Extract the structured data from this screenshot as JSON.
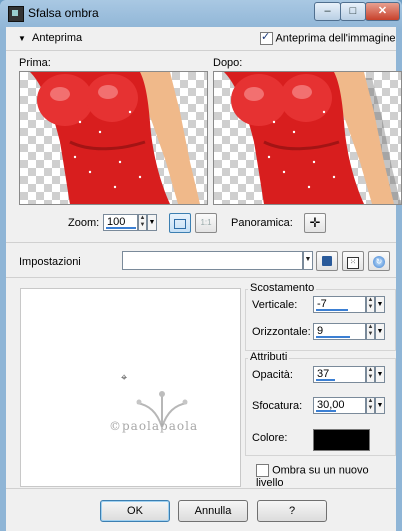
{
  "window": {
    "title": "Sfalsa ombra",
    "min": "–",
    "max": "□",
    "close": "✕"
  },
  "preview_section": {
    "collapse_label": "Anteprima",
    "show_preview_label": "Anteprima dell'immagine",
    "show_preview_checked": true,
    "before_label": "Prima:",
    "after_label": "Dopo:"
  },
  "zoom": {
    "label": "Zoom:",
    "value": "100",
    "pan_label": "Panoramica:"
  },
  "settings": {
    "label": "Impostazioni",
    "value": ""
  },
  "offset": {
    "group_label": "Scostamento",
    "vertical_label": "Verticale:",
    "vertical_value": "-7",
    "horizontal_label": "Orizzontale:",
    "horizontal_value": "9"
  },
  "attributes": {
    "group_label": "Attributi",
    "opacity_label": "Opacità:",
    "opacity_value": "37",
    "blur_label": "Sfocatura:",
    "blur_value": "30,00",
    "color_label": "Colore:",
    "color_value": "#000000"
  },
  "new_layer": {
    "label": "Ombra su un nuovo livello",
    "checked": false
  },
  "watermark": "©paolapaola",
  "buttons": {
    "ok": "OK",
    "cancel": "Annulla",
    "help": "?"
  }
}
